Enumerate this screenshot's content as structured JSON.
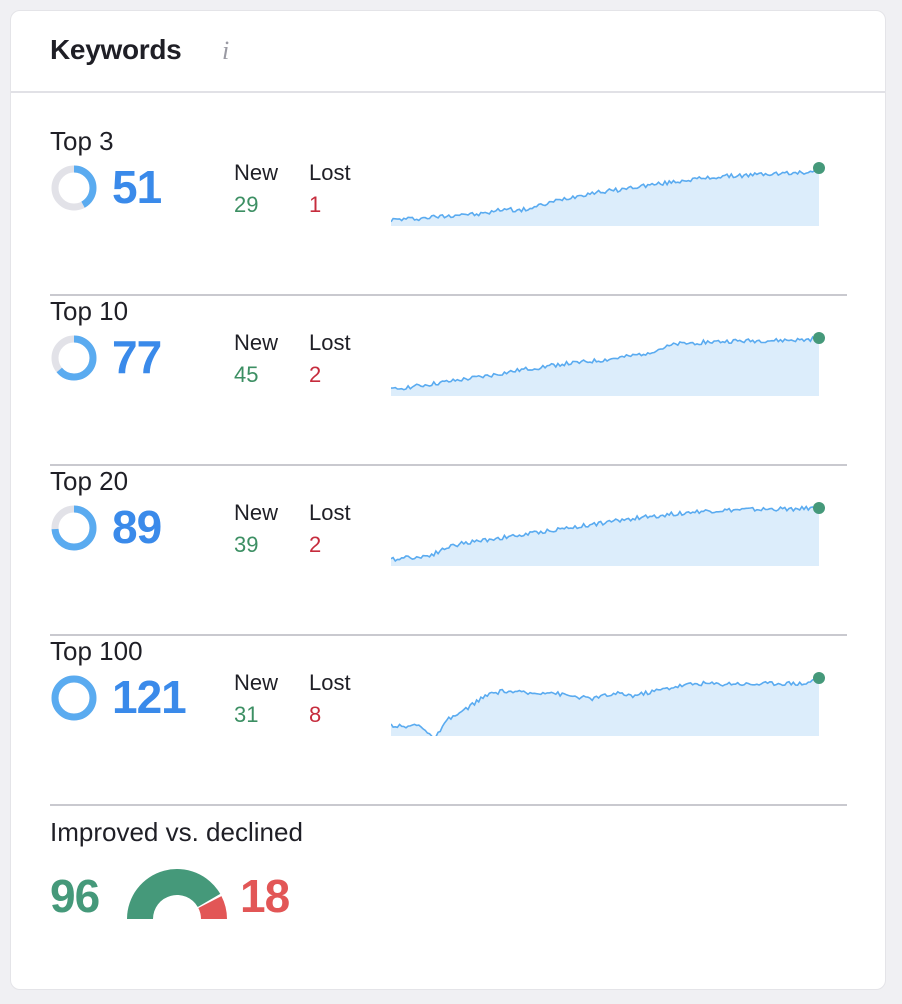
{
  "widget": {
    "title": "Keywords",
    "info_icon": "info-icon",
    "info_glyph": "i"
  },
  "labels": {
    "new": "New",
    "lost": "Lost"
  },
  "colors": {
    "count_blue": "#3a8aea",
    "donut_fill": "#5aabf0",
    "donut_track": "#e2e2e8",
    "new_green": "#3c8f63",
    "lost_red": "#c62c3d",
    "spark_line": "#5aabf0",
    "spark_area": "#dcedfb",
    "spark_dot": "#45997a",
    "improved_green": "#45997a",
    "declined_red": "#e25656"
  },
  "tiers": [
    {
      "label": "Top 3",
      "count": "51",
      "new": "29",
      "lost": "1",
      "donut_fraction": 0.42,
      "trend": [
        0.0,
        0.02,
        0.03,
        0.06,
        0.08,
        0.12,
        0.1,
        0.15,
        0.22,
        0.18,
        0.24,
        0.32,
        0.4,
        0.46,
        0.52,
        0.55,
        0.58,
        0.63,
        0.67,
        0.7,
        0.74,
        0.78,
        0.8,
        0.83,
        0.85,
        0.86,
        0.88,
        0.89,
        0.9,
        0.91,
        1.0
      ]
    },
    {
      "label": "Top 10",
      "count": "77",
      "new": "45",
      "lost": "2",
      "donut_fraction": 0.64,
      "trend": [
        0.0,
        0.05,
        0.08,
        0.12,
        0.16,
        0.2,
        0.24,
        0.28,
        0.33,
        0.38,
        0.42,
        0.46,
        0.5,
        0.52,
        0.55,
        0.58,
        0.62,
        0.66,
        0.72,
        0.8,
        0.88,
        0.9,
        0.92,
        0.93,
        0.94,
        0.94,
        0.95,
        0.95,
        0.96,
        0.96,
        1.0
      ]
    },
    {
      "label": "Top 20",
      "count": "89",
      "new": "39",
      "lost": "2",
      "donut_fraction": 0.74,
      "trend": [
        0.0,
        0.06,
        0.05,
        0.12,
        0.25,
        0.32,
        0.36,
        0.4,
        0.44,
        0.47,
        0.52,
        0.56,
        0.6,
        0.64,
        0.68,
        0.72,
        0.76,
        0.8,
        0.83,
        0.86,
        0.89,
        0.92,
        0.94,
        0.95,
        0.96,
        0.97,
        0.97,
        0.98,
        0.98,
        0.99,
        1.0
      ]
    },
    {
      "label": "Top 100",
      "count": "121",
      "new": "31",
      "lost": "8",
      "donut_fraction": 1.0,
      "trend": [
        0.1,
        0.05,
        0.12,
        -0.2,
        0.2,
        0.35,
        0.55,
        0.7,
        0.75,
        0.72,
        0.7,
        0.74,
        0.68,
        0.64,
        0.6,
        0.66,
        0.7,
        0.66,
        0.72,
        0.78,
        0.84,
        0.88,
        0.9,
        0.88,
        0.9,
        0.88,
        0.89,
        0.9,
        0.9,
        0.89,
        1.0
      ]
    }
  ],
  "improved_vs_declined": {
    "label": "Improved vs. declined",
    "improved": "96",
    "declined": "18",
    "improved_value": 96,
    "declined_value": 18
  }
}
